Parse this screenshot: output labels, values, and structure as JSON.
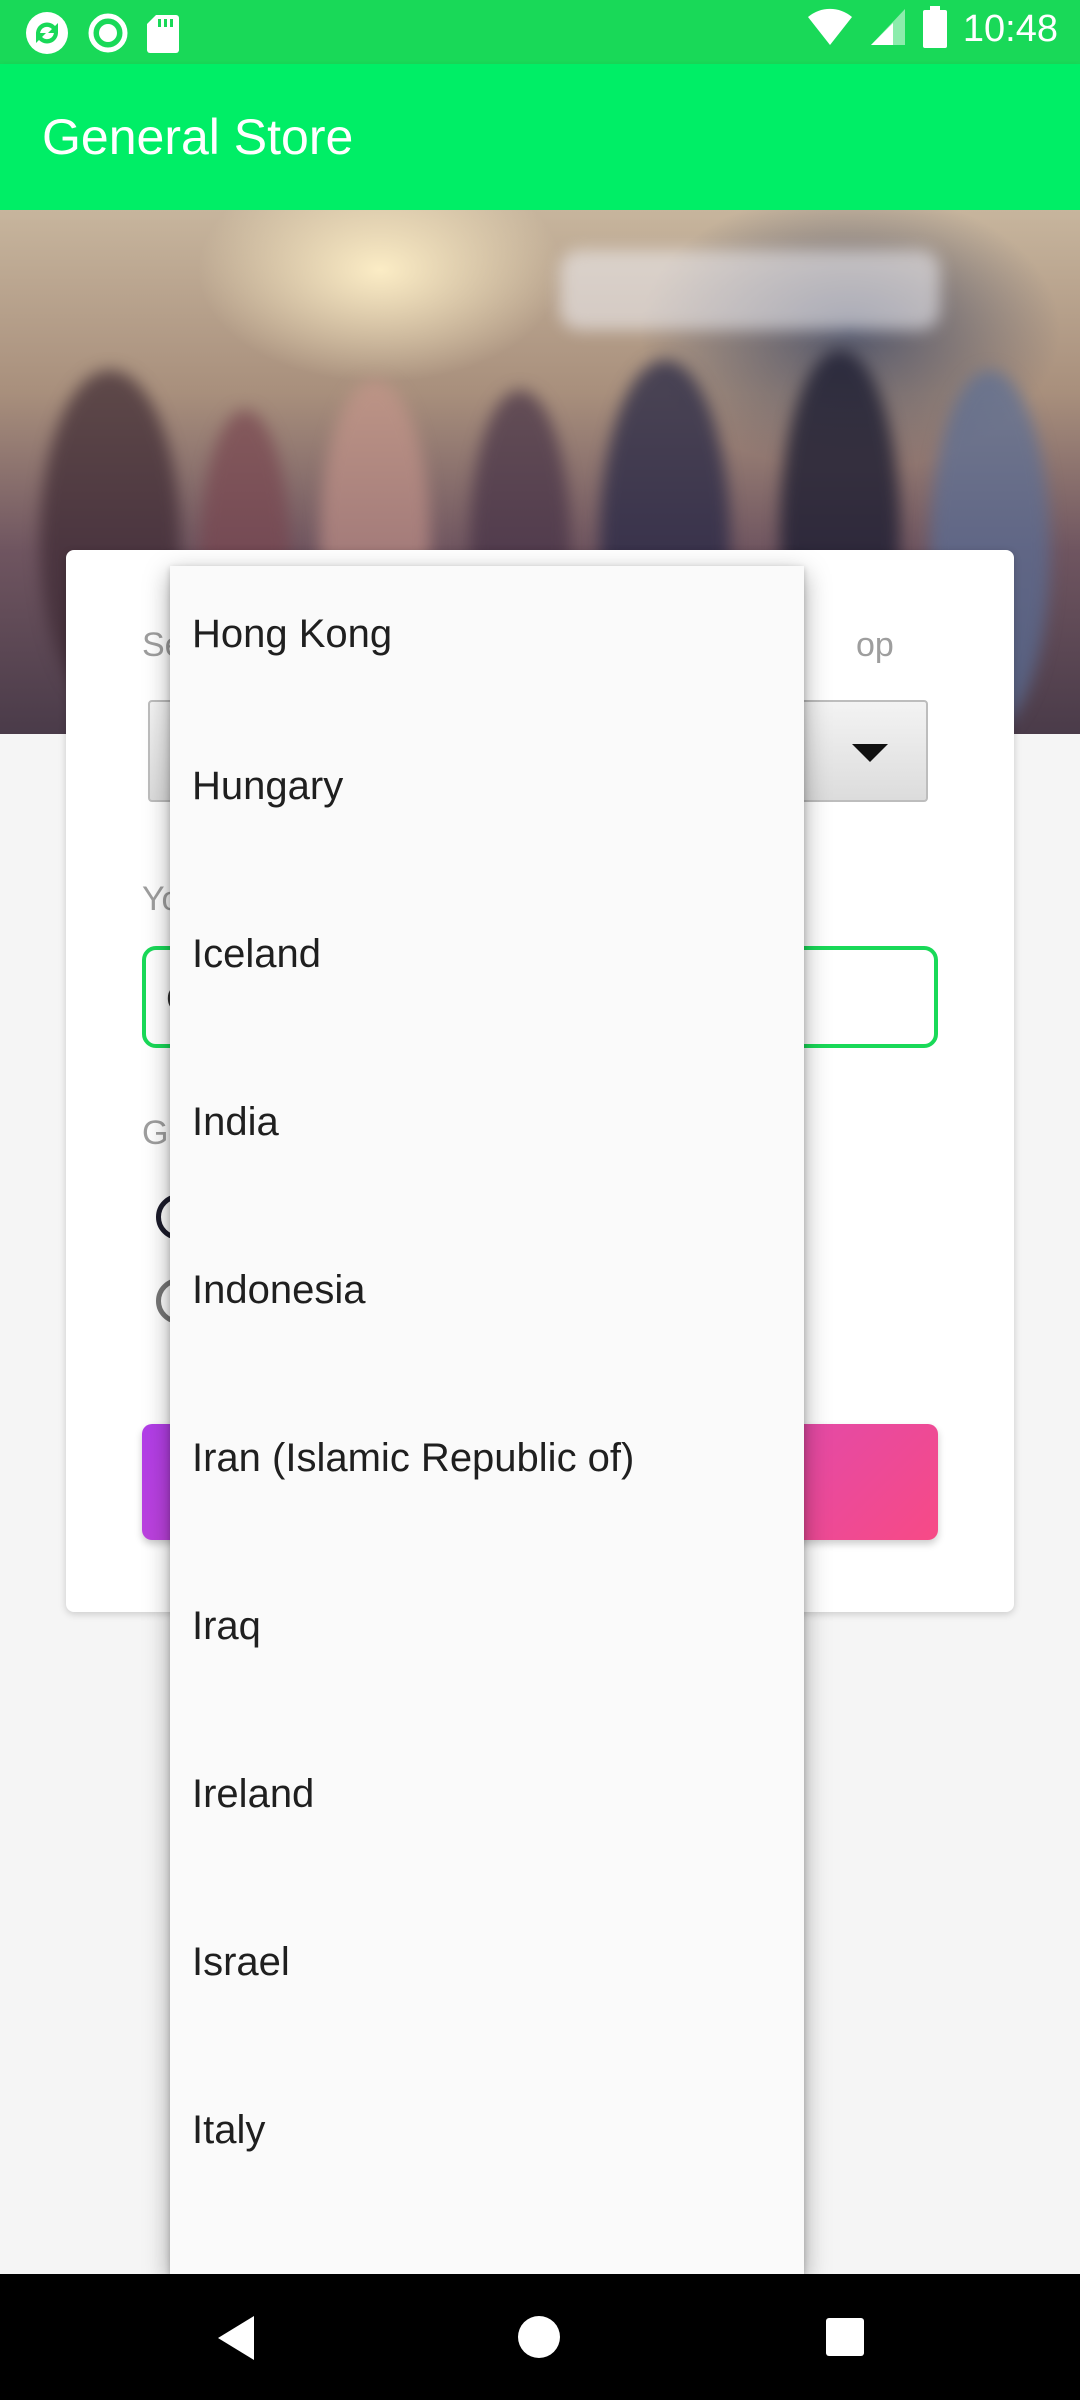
{
  "status_bar": {
    "time": "10:48",
    "left_icons": [
      "sync-icon",
      "record-icon",
      "sd-card-icon"
    ],
    "right_icons": [
      "wifi-icon",
      "cellular-icon",
      "battery-icon"
    ]
  },
  "app_bar": {
    "title": "General Store"
  },
  "form": {
    "country_label_start": "Se",
    "country_label_end": "op",
    "name_label": "Yo",
    "name_value": "C",
    "gender_label": "Ge",
    "shop_button_label": ""
  },
  "dropdown": {
    "items": [
      "Hong Kong",
      "Hungary",
      "Iceland",
      "India",
      "Indonesia",
      "Iran (Islamic Republic of)",
      "Iraq",
      "Ireland",
      "Israel",
      "Italy"
    ]
  },
  "colors": {
    "status_bar": "#19d958",
    "app_bar": "#00ee66",
    "accent": "#19d958",
    "button_gradient_start": "#b13ee8",
    "button_gradient_end": "#f74a86"
  },
  "nav_bar": {
    "buttons": [
      "back-icon",
      "home-icon",
      "recents-icon"
    ]
  }
}
